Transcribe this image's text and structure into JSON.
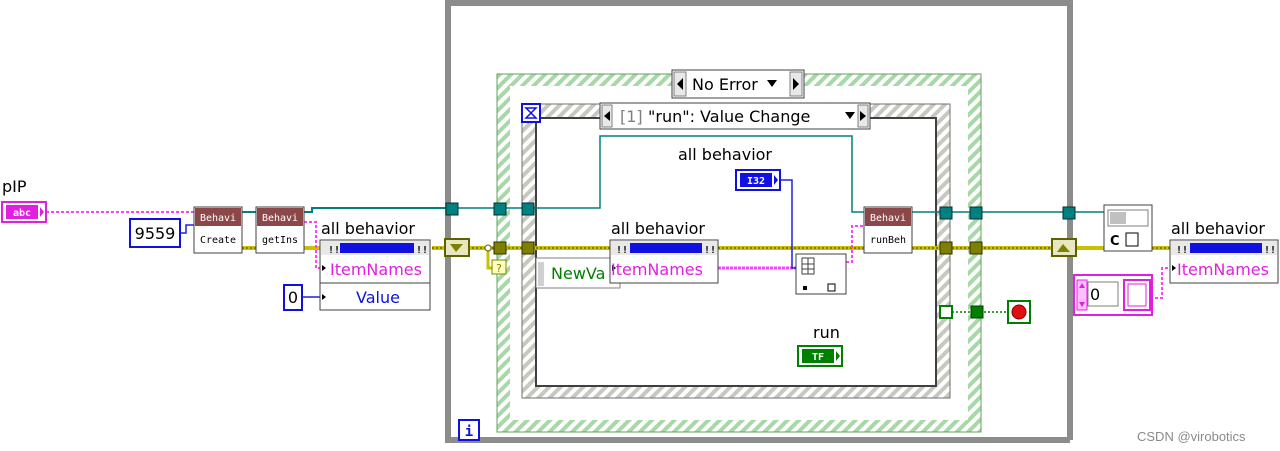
{
  "left_controls": {
    "pip_label": "pIP",
    "pip_terminal": "abc",
    "port_constant": "9559",
    "zero_constant": "0"
  },
  "nodes": {
    "create": {
      "top": "Behavi",
      "bottom": "Create"
    },
    "getins": {
      "top": "Behavi",
      "bottom": "getIns"
    },
    "runbeh": {
      "top": "Behavi",
      "bottom": "runBeh"
    }
  },
  "property_node_left": {
    "label": "all behavior",
    "prop1": "ItemNames",
    "prop2": "Value"
  },
  "case_structure": {
    "selector": "No Error"
  },
  "event_structure": {
    "selector_index": "[1]",
    "selector": "\"run\": Value Change",
    "newval": "NewVa"
  },
  "inner": {
    "constant_label": "all behavior",
    "i32_terminal": "I32",
    "property_label": "all behavior",
    "property_prop": "ItemNames",
    "run_label": "run",
    "run_terminal": "TF"
  },
  "loop": {
    "iteration_terminal": "i"
  },
  "right": {
    "property_label": "all behavior",
    "property_prop": "ItemNames",
    "array_index": "0",
    "close_glyph": "C"
  },
  "watermark": "CSDN @virobotics"
}
